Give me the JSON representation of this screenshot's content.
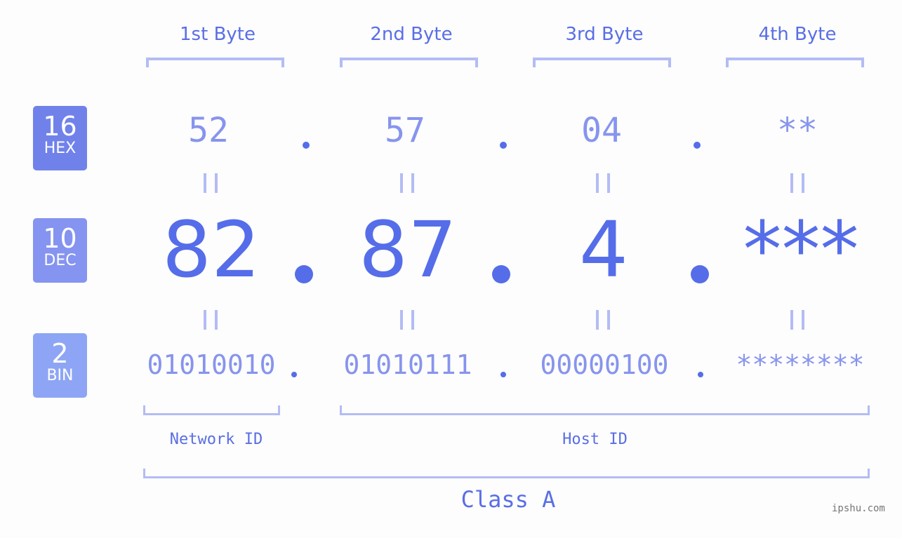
{
  "headers": [
    "1st Byte",
    "2nd Byte",
    "3rd Byte",
    "4th Byte"
  ],
  "badges": {
    "hex": {
      "num": "16",
      "label": "HEX",
      "color": "#7082ea"
    },
    "dec": {
      "num": "10",
      "label": "DEC",
      "color": "#8594f0"
    },
    "bin": {
      "num": "2",
      "label": "BIN",
      "color": "#8ea5f5"
    }
  },
  "hex": [
    "52",
    "57",
    "04",
    "**"
  ],
  "dec": [
    "82",
    "87",
    "4",
    "***"
  ],
  "bin": [
    "01010010",
    "01010111",
    "00000100",
    "********"
  ],
  "labels": {
    "network": "Network ID",
    "host": "Host ID",
    "class": "Class A"
  },
  "watermark": "ipshu.com",
  "colors": {
    "primary": "#566de9",
    "light": "#8794ee",
    "bracket": "#b3bcf5"
  }
}
